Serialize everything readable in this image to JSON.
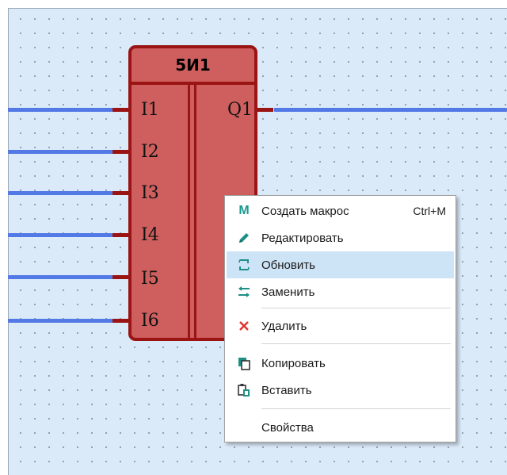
{
  "block": {
    "title": "5И1",
    "inputs": [
      "I1",
      "I2",
      "I3",
      "I4",
      "I5",
      "I6"
    ],
    "outputs": [
      "Q1"
    ]
  },
  "menu": {
    "items": [
      {
        "label": "Создать макрос",
        "shortcut": "Ctrl+M",
        "icon": "macro-m-icon"
      },
      {
        "label": "Редактировать",
        "icon": "pencil-icon"
      },
      {
        "label": "Обновить",
        "icon": "refresh-icon",
        "highlighted": true
      },
      {
        "label": "Заменить",
        "icon": "swap-arrows-icon"
      },
      {
        "label": "Удалить",
        "icon": "delete-x-icon"
      },
      {
        "label": "Копировать",
        "icon": "copy-icon"
      },
      {
        "label": "Вставить",
        "icon": "paste-icon"
      },
      {
        "label": "Свойства",
        "icon": ""
      }
    ]
  },
  "colors": {
    "block_fill": "#cf5f5f",
    "block_border": "#9b1414",
    "wire": "#5379e6",
    "highlight": "#cde3f6"
  }
}
